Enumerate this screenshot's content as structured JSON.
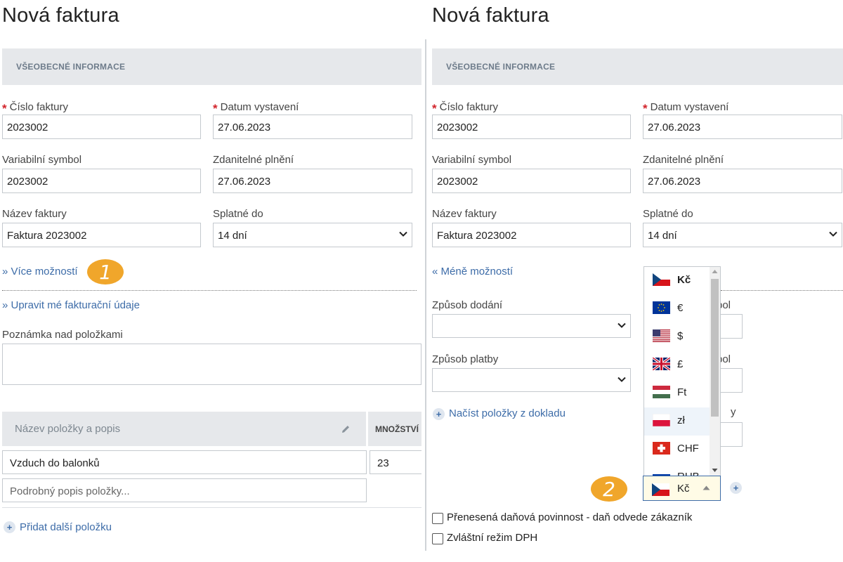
{
  "left": {
    "title": "Nová faktura",
    "section": "VŠEOBECNÉ INFORMACE",
    "invoice_number_label": "Číslo faktury",
    "invoice_number": "2023002",
    "issue_date_label": "Datum vystavení",
    "issue_date": "27.06.2023",
    "var_symbol_label": "Variabilní symbol",
    "var_symbol": "2023002",
    "taxable_label": "Zdanitelné plnění",
    "taxable_date": "27.06.2023",
    "name_label": "Název faktury",
    "name_value": "Faktura 2023002",
    "due_label": "Splatné do",
    "due_value": "14 dní",
    "more_options": "» Více možností",
    "badge": "1",
    "edit_billing": "» Upravit mé fakturační údaje",
    "note_label": "Poznámka nad položkami",
    "table": {
      "col_name": "Název položky a popis",
      "col_qty": "MNOŽSTVÍ",
      "item_name": "Vzduch do balonků",
      "item_qty": "23",
      "item_desc_placeholder": "Podrobný popis položky..."
    },
    "add_item": "Přidat další položku"
  },
  "right": {
    "title": "Nová faktura",
    "section": "VŠEOBECNÉ INFORMACE",
    "invoice_number_label": "Číslo faktury",
    "invoice_number": "2023002",
    "issue_date_label": "Datum vystavení",
    "issue_date": "27.06.2023",
    "var_symbol_label": "Variabilní symbol",
    "var_symbol": "2023002",
    "taxable_label": "Zdanitelné plnění",
    "taxable_date": "27.06.2023",
    "name_label": "Název faktury",
    "name_value": "Faktura 2023002",
    "due_label": "Splatné do",
    "due_value": "14 dní",
    "less_options": "« Méně možností",
    "delivery_label": "Způsob dodání",
    "payment_label": "Způsob platby",
    "partial_labels": [
      "bol",
      "bol",
      "y"
    ],
    "load_items": "Načíst položky z dokladu",
    "currency_options": [
      {
        "code": "Kč",
        "flag": "cz"
      },
      {
        "code": "€",
        "flag": "eu"
      },
      {
        "code": "$",
        "flag": "us"
      },
      {
        "code": "£",
        "flag": "gb"
      },
      {
        "code": "Ft",
        "flag": "hu"
      },
      {
        "code": "zł",
        "flag": "pl"
      },
      {
        "code": "CHF",
        "flag": "ch"
      },
      {
        "code": "RUB",
        "flag": "ru"
      }
    ],
    "selected_currency": "Kč",
    "badge": "2",
    "reverse_charge": "Přenesená daňová povinnost - daň odvede zákazník",
    "special_vat": "Zvláštní režim DPH"
  },
  "colors": {
    "accent_link": "#3d6ca8",
    "badge": "#f0a62b",
    "required": "#d2232a",
    "section_bg": "#e6e8eb"
  }
}
